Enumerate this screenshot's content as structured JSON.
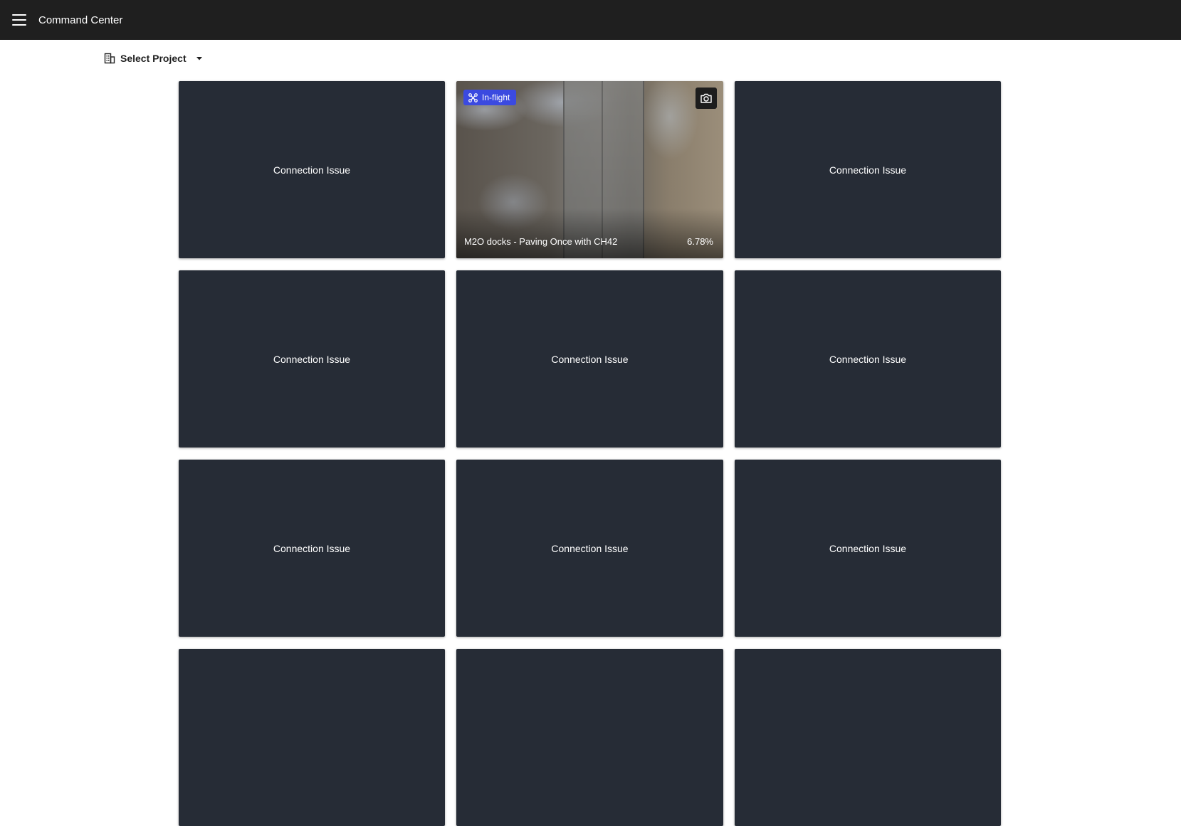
{
  "app": {
    "title": "Command Center",
    "menu_icon": "hamburger-menu-icon"
  },
  "project_select": {
    "label": "Select Project",
    "icon": "building-icon",
    "caret_icon": "caret-down-icon"
  },
  "tiles": [
    {
      "status": "Connection Issue"
    },
    {
      "live": true,
      "badge": "In-flight",
      "badge_icon": "drone-icon",
      "camera_icon": "camera-icon",
      "mission": "M2O docks - Paving Once with CH42",
      "progress": "6.78%",
      "badge_color": "#3b4ae0"
    },
    {
      "status": "Connection Issue"
    },
    {
      "status": "Connection Issue"
    },
    {
      "status": "Connection Issue"
    },
    {
      "status": "Connection Issue"
    },
    {
      "status": "Connection Issue"
    },
    {
      "status": "Connection Issue"
    },
    {
      "status": "Connection Issue"
    },
    {
      "status": ""
    },
    {
      "status": ""
    },
    {
      "status": ""
    }
  ],
  "colors": {
    "topbar": "#1f1f1f",
    "tile": "#262c36",
    "accent": "#3b4ae0"
  }
}
